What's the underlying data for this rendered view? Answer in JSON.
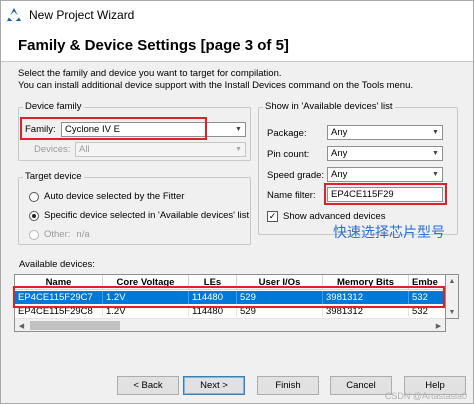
{
  "window": {
    "title": "New Project Wizard"
  },
  "header": {
    "heading": "Family & Device Settings [page 3 of 5]"
  },
  "intro": {
    "line1": "Select the family and device you want to target for compilation.",
    "line2": "You can install additional device support with the Install Devices command on the Tools menu."
  },
  "device_family": {
    "legend": "Device family",
    "family_label": "Family:",
    "family_value": "Cyclone IV E",
    "devices_label": "Devices:",
    "devices_value": "All"
  },
  "target_device": {
    "legend": "Target device",
    "auto_label": "Auto device selected by the Fitter",
    "specific_label": "Specific device selected in 'Available devices' list",
    "other_label": "Other:",
    "other_value": "n/a"
  },
  "show_panel": {
    "legend": "Show in 'Available devices' list",
    "package_label": "Package:",
    "package_value": "Any",
    "pin_count_label": "Pin count:",
    "pin_count_value": "Any",
    "speed_grade_label": "Speed grade:",
    "speed_grade_value": "Any",
    "name_filter_label": "Name filter:",
    "name_filter_value": "EP4CE115F29",
    "show_advanced_label": "Show advanced devices",
    "show_advanced_checked": true
  },
  "annotation": "快速选择芯片型号",
  "available_devices": {
    "label": "Available devices:",
    "columns": [
      "Name",
      "Core Voltage",
      "LEs",
      "User I/Os",
      "Memory Bits",
      "Embe"
    ],
    "rows": [
      [
        "EP4CE115F29C7",
        "1.2V",
        "114480",
        "529",
        "3981312",
        "532"
      ],
      [
        "EP4CE115F29C8",
        "1.2V",
        "114480",
        "529",
        "3981312",
        "532"
      ]
    ],
    "selected_row": 0
  },
  "buttons": {
    "back": "< Back",
    "next": "Next >",
    "finish": "Finish",
    "cancel": "Cancel",
    "help": "Help"
  },
  "watermark": "CSDN @Artastasia0",
  "colors": {
    "selection": "#0078d7",
    "highlight_box": "#e2202b",
    "annotation": "#2a6fd6"
  }
}
